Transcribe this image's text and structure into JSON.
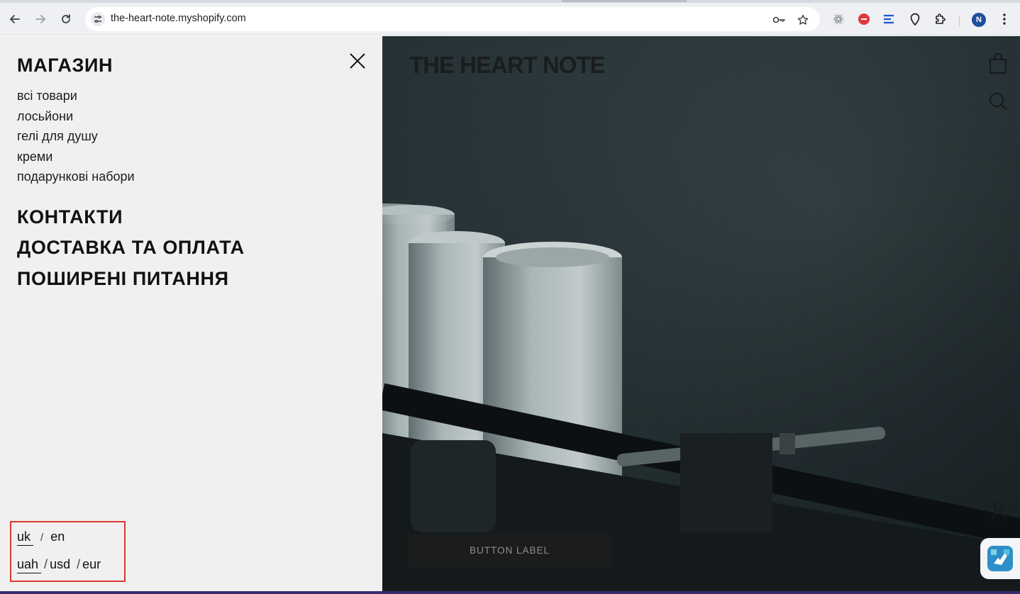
{
  "browser": {
    "url": "the-heart-note.myshopify.com",
    "profile_initial": "N",
    "icons": [
      "back-arrow-icon",
      "forward-arrow-icon",
      "reload-icon",
      "site-info-icon",
      "password-key-icon",
      "bookmark-star-icon",
      "react-devtools-icon",
      "extension-red-icon",
      "extension-blue-icon",
      "location-pin-icon",
      "puzzle-extensions-icon",
      "kebab-menu-icon"
    ]
  },
  "menu": {
    "shop_heading": "МАГАЗИН",
    "shop_items": [
      "всі товари",
      "лосьйони",
      "гелі для душу",
      "креми",
      "подарункові набори"
    ],
    "contacts": "КОНТАКТИ",
    "delivery": "ДОСТАВКА ТА ОПЛАТА",
    "faq": "ПОШИРЕНІ ПИТАННЯ",
    "languages": {
      "active": "uk",
      "other": "en"
    },
    "currencies": {
      "active": "uah",
      "others": [
        "usd",
        "eur"
      ]
    },
    "slash": "/",
    "highlight_color": "#d93a31"
  },
  "hero": {
    "brand": "THE HEART NOTE",
    "button_label": "BUTTON LABEL",
    "icons": [
      "shopping-bag-icon",
      "search-icon",
      "user-icon",
      "help-hand-icon"
    ]
  }
}
